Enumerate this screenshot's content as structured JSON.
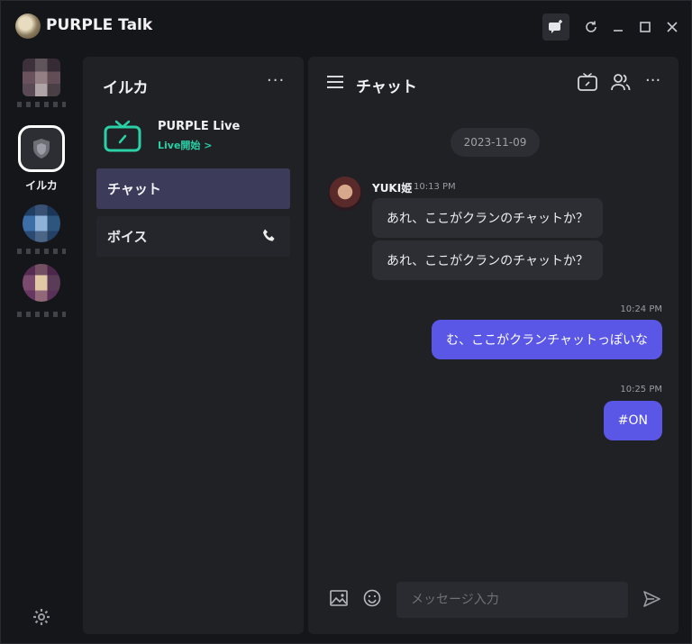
{
  "app": {
    "title": "PURPLE Talk"
  },
  "titlebar": {
    "icons": [
      "chat-add-icon",
      "refresh-icon",
      "minimize-icon",
      "maximize-icon",
      "close-icon"
    ]
  },
  "rail": {
    "active_guild_label": "イルカ",
    "icons": [
      "settings-icon"
    ]
  },
  "channels": {
    "title": "イルカ",
    "more": "···",
    "live": {
      "name": "PURPLE Live",
      "action": "Live開始 >"
    },
    "items": [
      {
        "label": "チャット",
        "selected": true
      },
      {
        "label": "ボイス",
        "icon": "phone-icon"
      }
    ]
  },
  "chat": {
    "title": "チャット",
    "more": "···",
    "date": "2023-11-09",
    "incoming": {
      "sender": "YUKI姫",
      "time": "10:13 PM",
      "messages": [
        "あれ、ここがクランのチャットか？",
        "あれ、ここがクランのチャットか？"
      ]
    },
    "outgoing": [
      {
        "time": "10:24 PM",
        "text": "む、ここがクランチャットっぽいな"
      },
      {
        "time": "10:25 PM",
        "text": "#ON"
      }
    ],
    "composer": {
      "placeholder": "メッセージ入力",
      "value": ""
    }
  },
  "colors": {
    "accent": "#5b57e6",
    "live_green": "#2ad0a6",
    "selected_channel": "#3c3c5a"
  }
}
